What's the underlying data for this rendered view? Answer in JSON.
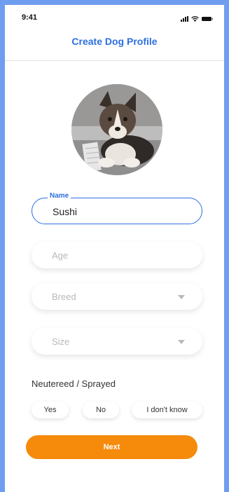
{
  "status_bar": {
    "time": "9:41",
    "icons": [
      "signal-icon",
      "wifi-icon",
      "battery-icon"
    ]
  },
  "header": {
    "title": "Create Dog Profile"
  },
  "avatar": {
    "icon": "dog-photo"
  },
  "form": {
    "name": {
      "label": "Name",
      "value": "Sushi"
    },
    "age": {
      "placeholder": "Age"
    },
    "breed": {
      "placeholder": "Breed",
      "icon": "chevron-down-icon"
    },
    "size": {
      "placeholder": "Size",
      "icon": "chevron-down-icon"
    }
  },
  "neutered": {
    "label": "Neutereed / Sprayed",
    "options": [
      "Yes",
      "No",
      "I don't know"
    ]
  },
  "actions": {
    "next_label": "Next"
  },
  "colors": {
    "accent": "#2e6fe0",
    "primary_button": "#f58a0b",
    "background": "#6f9df0"
  }
}
